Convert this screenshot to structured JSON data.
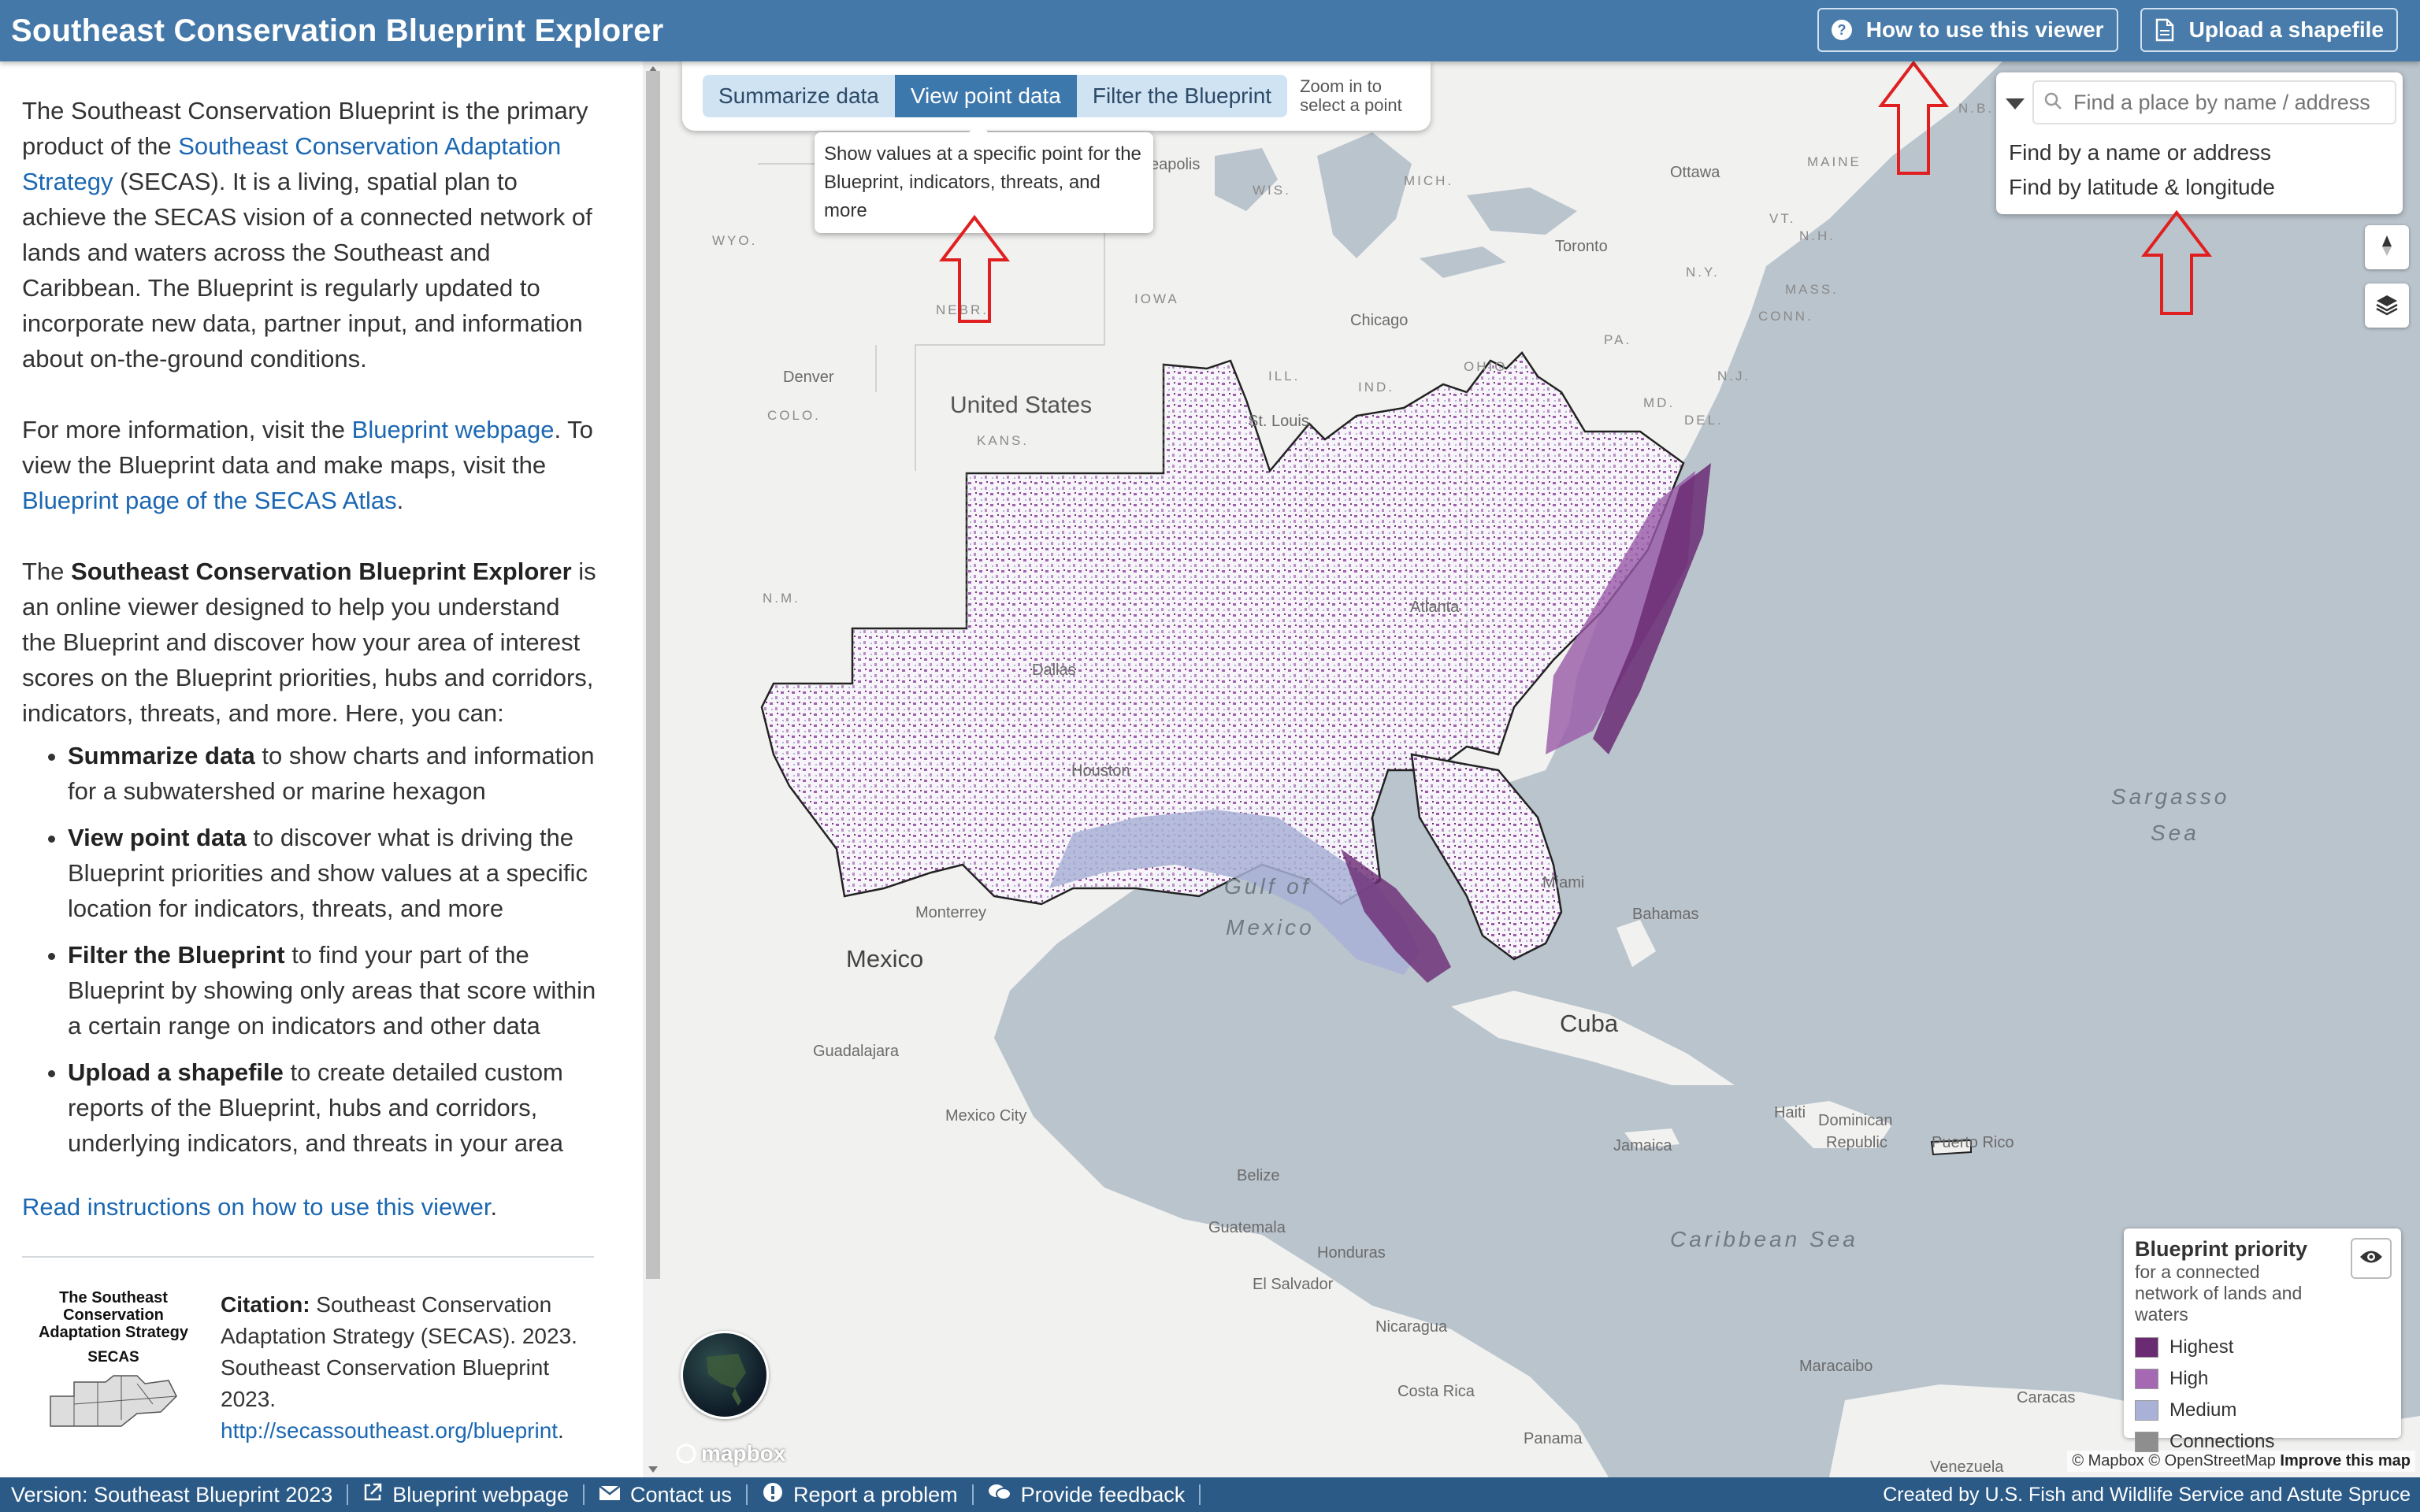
{
  "header": {
    "title": "Southeast  Conservation Blueprint Explorer",
    "how_to_label": "How to use this viewer",
    "upload_label": "Upload a shapefile"
  },
  "sidebar": {
    "intro": {
      "t1": "The Southeast Conservation Blueprint is the primary product of the ",
      "link1": "Southeast Conservation Adaptation Strategy",
      "t2": " (SECAS). It is a living, spatial plan to achieve the SECAS vision of a connected network of lands and waters across the Southeast and Caribbean. The Blueprint is regularly updated to incorporate new data, partner input, and information about on-the-ground conditions."
    },
    "more_info": {
      "t1": "For more information, visit the ",
      "link1": "Blueprint webpage",
      "t2": ". To view the Blueprint data and make maps, visit the ",
      "link2": "Blueprint page of the SECAS Atlas",
      "t3": "."
    },
    "explorer": {
      "t1": "The ",
      "bold": "Southeast Conservation Blueprint Explorer",
      "t2": " is an online viewer designed to help you understand the Blueprint and discover how your area of interest scores on the Blueprint priorities, hubs and corridors, indicators, threats, and more. Here, you can:"
    },
    "bullets": [
      {
        "bold": "Summarize data",
        "text": " to show charts and information for a subwatershed or marine hexagon"
      },
      {
        "bold": "View point data",
        "text": " to discover what is driving the Blueprint priorities and show values at a specific location for indicators, threats, and more"
      },
      {
        "bold": "Filter the Blueprint",
        "text": " to find your part of the Blueprint by showing only areas that score within a certain range on indicators and other data"
      },
      {
        "bold": "Upload a shapefile",
        "text": " to create detailed custom reports of the Blueprint, hubs and corridors, underlying indicators, and threats in your area"
      }
    ],
    "read_instructions": "Read instructions on how to use this viewer",
    "read_period": ".",
    "logo": {
      "name": "The Southeast Conservation Adaptation Strategy",
      "abbr": "SECAS"
    },
    "citation": {
      "label": "Citation:",
      "text": " Southeast Conservation Adaptation Strategy (SECAS). 2023. Southeast Conservation Blueprint 2023. ",
      "url": "http://secassoutheast.org/blueprint",
      "end": "."
    }
  },
  "modes": {
    "summarize": "Summarize data",
    "view_point": "View point data",
    "filter": "Filter the Blueprint",
    "zoom_hint_1": "Zoom in to",
    "zoom_hint_2": "select a point",
    "tooltip": "Show values at a specific point for the Blueprint, indicators, threats, and more"
  },
  "search": {
    "placeholder": "Find a place by name / address",
    "option_name": "Find by a name or address",
    "option_latlon": "Find by latitude & longitude"
  },
  "map_labels": {
    "united_states": "United States",
    "mexico": "Mexico",
    "cuba": "Cuba",
    "gulf_1": "Gulf of",
    "gulf_2": "Mexico",
    "sargasso_1": "Sargasso",
    "sargasso_2": "Sea",
    "caribbean": "Caribbean Sea",
    "bahamas": "Bahamas",
    "haiti": "Haiti",
    "dominican_1": "Dominican",
    "dominican_2": "Republic",
    "puerto_rico": "Puerto Rico",
    "jamaica": "Jamaica",
    "belize": "Belize",
    "guatemala": "Guatemala",
    "honduras": "Honduras",
    "el_salvador": "El Salvador",
    "nicaragua": "Nicaragua",
    "costa_rica": "Costa Rica",
    "panama": "Panama",
    "maracaibo": "Maracaibo",
    "caracas": "Caracas",
    "venezuela": "Venezuela",
    "monterrey": "Monterrey",
    "guadalajara": "Guadalajara",
    "mexico_city": "Mexico City",
    "denver": "Denver",
    "chicago": "Chicago",
    "toronto": "Toronto",
    "ottawa": "Ottawa",
    "minneapolis": "eapolis",
    "st_louis": "St. Louis",
    "dallas": "Dallas",
    "houston": "Houston",
    "atlanta": "Atlanta",
    "miami": "Miami",
    "wyo": "WYO.",
    "colo": "COLO.",
    "kans": "KANS.",
    "nebr": "NEBR.",
    "iowa": "IOWA",
    "wis": "WIS.",
    "mich": "MICH.",
    "ill": "ILL.",
    "ind": "IND.",
    "ohio": "OHIO",
    "pa": "PA.",
    "ny": "N.Y.",
    "vt": "VT.",
    "nh": "N.H.",
    "mass": "MASS.",
    "conn": "CONN.",
    "nj": "N.J.",
    "md": "MD.",
    "del": "DEL.",
    "maine": "MAINE",
    "nb": "N.B.",
    "nm": "N.M."
  },
  "legend": {
    "title": "Blueprint priority",
    "subtitle": "for a connected network of lands and waters",
    "items": [
      {
        "label": "Highest",
        "color": "#6b2b73"
      },
      {
        "label": "High",
        "color": "#a569b3"
      },
      {
        "label": "Medium",
        "color": "#a9b2d6"
      },
      {
        "label": "Connections",
        "color": "#8e8e8e"
      }
    ]
  },
  "attribution": {
    "mapbox": "© Mapbox",
    "osm": "© OpenStreetMap",
    "improve": "Improve this map",
    "logo": "mapbox"
  },
  "footer": {
    "version": "Version: Southeast Blueprint 2023",
    "blueprint_webpage": "Blueprint webpage",
    "contact": "Contact us",
    "report": "Report a problem",
    "feedback": "Provide feedback",
    "credit": "Created by U.S. Fish and Wildlife Service and Astute Spruce"
  },
  "colors": {
    "header": "#4478a8",
    "footer": "#2b5a87",
    "link": "#1b67b2",
    "active_mode": "#3d78ad",
    "inactive_mode": "#cfe3f3",
    "annotation_arrow": "#e02020"
  }
}
